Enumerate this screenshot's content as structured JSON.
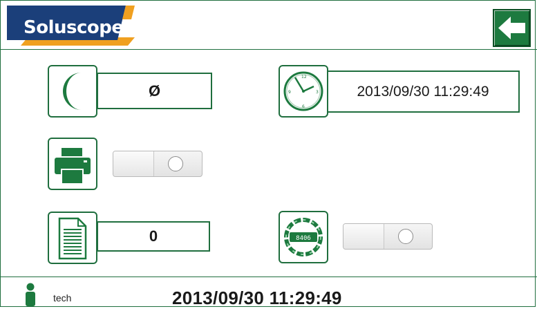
{
  "app": {
    "brand": "Soluscope"
  },
  "header": {
    "back_icon": "arrow-left-icon"
  },
  "settings": {
    "night_mode": {
      "icon": "moon-icon",
      "value": "Ø"
    },
    "clock": {
      "icon": "clock-icon",
      "value": "2013/09/30 11:29:49"
    },
    "printer": {
      "icon": "printer-icon",
      "toggle_state": "off"
    },
    "document": {
      "icon": "document-icon",
      "value": "0"
    },
    "counter": {
      "icon": "counter-icon",
      "counter_text": "8406",
      "toggle_state": "off"
    }
  },
  "footer": {
    "user_icon": "person-icon",
    "user": "tech",
    "datetime": "2013/09/30 11:29:49"
  },
  "colors": {
    "primary_green": "#1d7a3f",
    "brand_navy": "#1b3f7a",
    "brand_orange": "#f0a020"
  }
}
